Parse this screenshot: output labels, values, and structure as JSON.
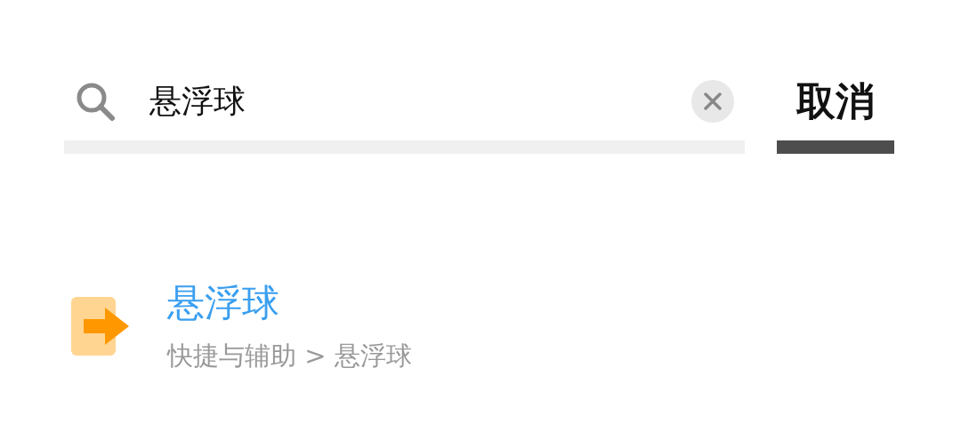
{
  "search": {
    "value": "悬浮球"
  },
  "cancel_button": {
    "label": "取消"
  },
  "results": [
    {
      "title": "悬浮球",
      "path": "快捷与辅助 > 悬浮球"
    }
  ]
}
